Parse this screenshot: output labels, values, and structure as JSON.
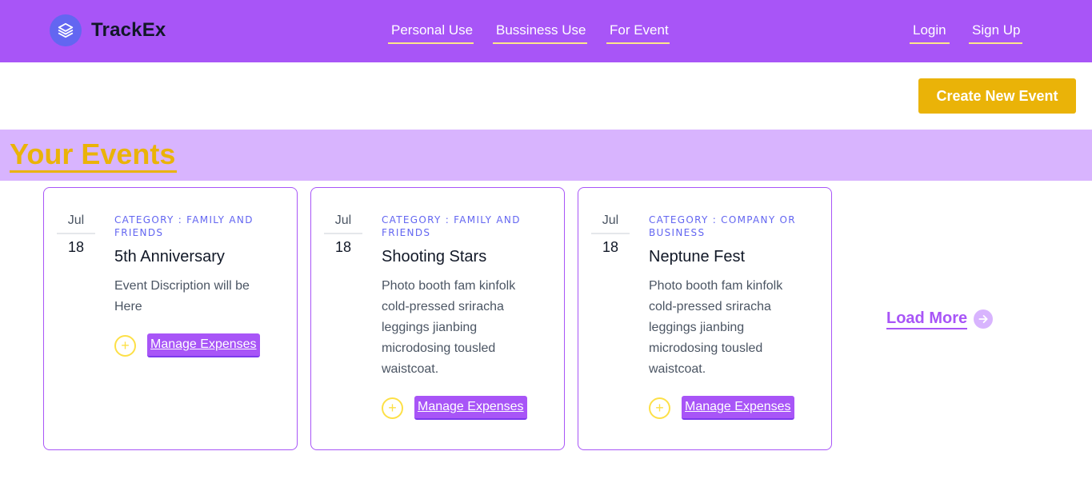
{
  "brand": {
    "name": "TrackEx",
    "icon": "layers-icon"
  },
  "nav": {
    "center": [
      "Personal Use",
      "Bussiness Use",
      "For Event"
    ],
    "right": [
      "Login",
      "Sign Up"
    ]
  },
  "create_button_label": "Create New Event",
  "section_title": "Your Events",
  "events": [
    {
      "month": "Jul",
      "day": "18",
      "category": "CATEGORY : FAMILY AND FRIENDS",
      "title": "5th Anniversary",
      "description": "Event Discription will be Here",
      "manage_label": "Manage Expenses",
      "add_icon": "plus-circle-icon"
    },
    {
      "month": "Jul",
      "day": "18",
      "category": "CATEGORY : FAMILY AND FRIENDS",
      "title": "Shooting Stars",
      "description": "Photo booth fam kinfolk cold-pressed sriracha leggings jianbing microdosing tousled waistcoat.",
      "manage_label": "Manage Expenses",
      "add_icon": "plus-circle-icon"
    },
    {
      "month": "Jul",
      "day": "18",
      "category": "CATEGORY : COMPANY OR BUSINESS",
      "title": "Neptune Fest",
      "description": "Photo booth fam kinfolk cold-pressed sriracha leggings jianbing microdosing tousled waistcoat.",
      "manage_label": "Manage Expenses",
      "add_icon": "plus-circle-icon"
    }
  ],
  "load_more": {
    "label": "Load More",
    "icon": "arrow-right-circle-icon"
  },
  "colors": {
    "header_bg": "#a855f7",
    "accent_yellow": "#eab308",
    "band_bg": "#d8b4fe",
    "category_text": "#6366f1"
  }
}
